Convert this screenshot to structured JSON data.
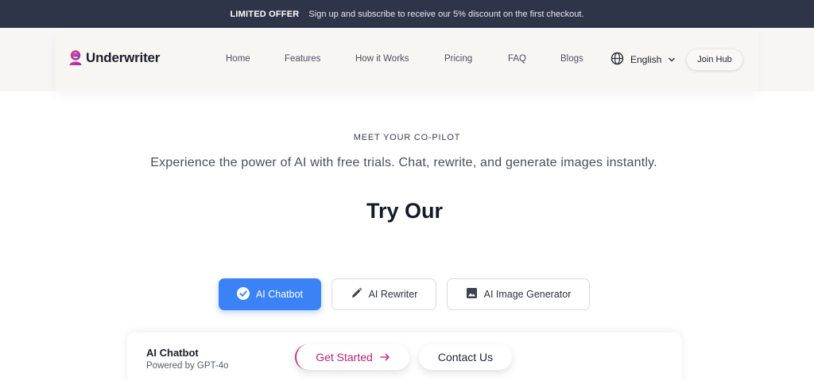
{
  "promo": {
    "tag": "LIMITED OFFER",
    "message": "Sign up and subscribe to receive our 5% discount on the first checkout."
  },
  "brand": {
    "name": "Underwriter",
    "subtext": "",
    "accent": "#c0368f"
  },
  "nav": {
    "items": [
      {
        "label": "Home"
      },
      {
        "label": "Features"
      },
      {
        "label": "How it Works"
      },
      {
        "label": "Pricing"
      },
      {
        "label": "FAQ"
      },
      {
        "label": "Blogs"
      }
    ],
    "language": "English",
    "join_label": "Join Hub"
  },
  "hero": {
    "eyebrow": "MEET YOUR CO-PILOT",
    "subtitle": "Experience the power of AI with free trials. Chat, rewrite, and generate images instantly.",
    "title": "Try Our"
  },
  "tabs": [
    {
      "label": "AI Chatbot",
      "icon": "check-circle-icon",
      "active": true
    },
    {
      "label": "AI Rewriter",
      "icon": "pencil-icon",
      "active": false
    },
    {
      "label": "AI Image Generator",
      "icon": "image-icon",
      "active": false
    }
  ],
  "card": {
    "title": "AI Chatbot",
    "subtitle": "Powered by GPT-4o"
  },
  "cta": {
    "get_started": "Get Started",
    "contact": "Contact Us"
  },
  "colors": {
    "promo_bg": "#2f3548",
    "active_tab": "#3b82f6",
    "accent_pink": "#b4237a"
  }
}
